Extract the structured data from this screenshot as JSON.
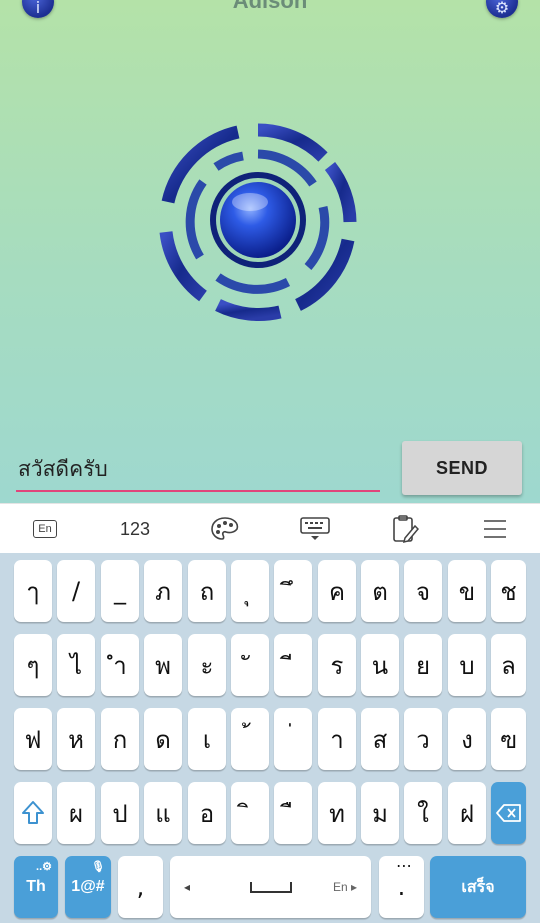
{
  "app": {
    "title": "Adison",
    "accent": "#e0457b",
    "orb_color": "#1d3fbf"
  },
  "compose": {
    "message_value": "สวัสดีครับ",
    "send_label": "SEND"
  },
  "keyboard_toolbar": {
    "lang_label": "En",
    "numbers_label": "123",
    "icons": [
      "palette-icon",
      "keyboard-hide-icon",
      "clipboard-icon",
      "menu-icon"
    ]
  },
  "keyboard": {
    "row1": [
      "ๅ",
      "/",
      "_",
      "ภ",
      "ถ",
      "ุ",
      "ึ",
      "ค",
      "ต",
      "จ",
      "ข",
      "ช"
    ],
    "row2": [
      "ๆ",
      "ไ",
      "ำ",
      "พ",
      "ะ",
      "ั",
      "ี",
      "ร",
      "น",
      "ย",
      "บ",
      "ล"
    ],
    "row3": [
      "ฟ",
      "ห",
      "ก",
      "ด",
      "เ",
      "้",
      "่",
      "า",
      "ส",
      "ว",
      "ง",
      "ฃ"
    ],
    "row4": [
      "ผ",
      "ป",
      "แ",
      "อ",
      "ิ",
      "ื",
      "ท",
      "ม",
      "ใ",
      "ฝ"
    ],
    "lang_key": "Th",
    "symbols_key": "1@#",
    "comma_key": ",",
    "space_hint": "En",
    "period_key": ".",
    "enter_key": "เสร็จ",
    "key_color": "#ffffff",
    "action_color": "#4a9fd8",
    "background_color": "#c6d8e4"
  }
}
